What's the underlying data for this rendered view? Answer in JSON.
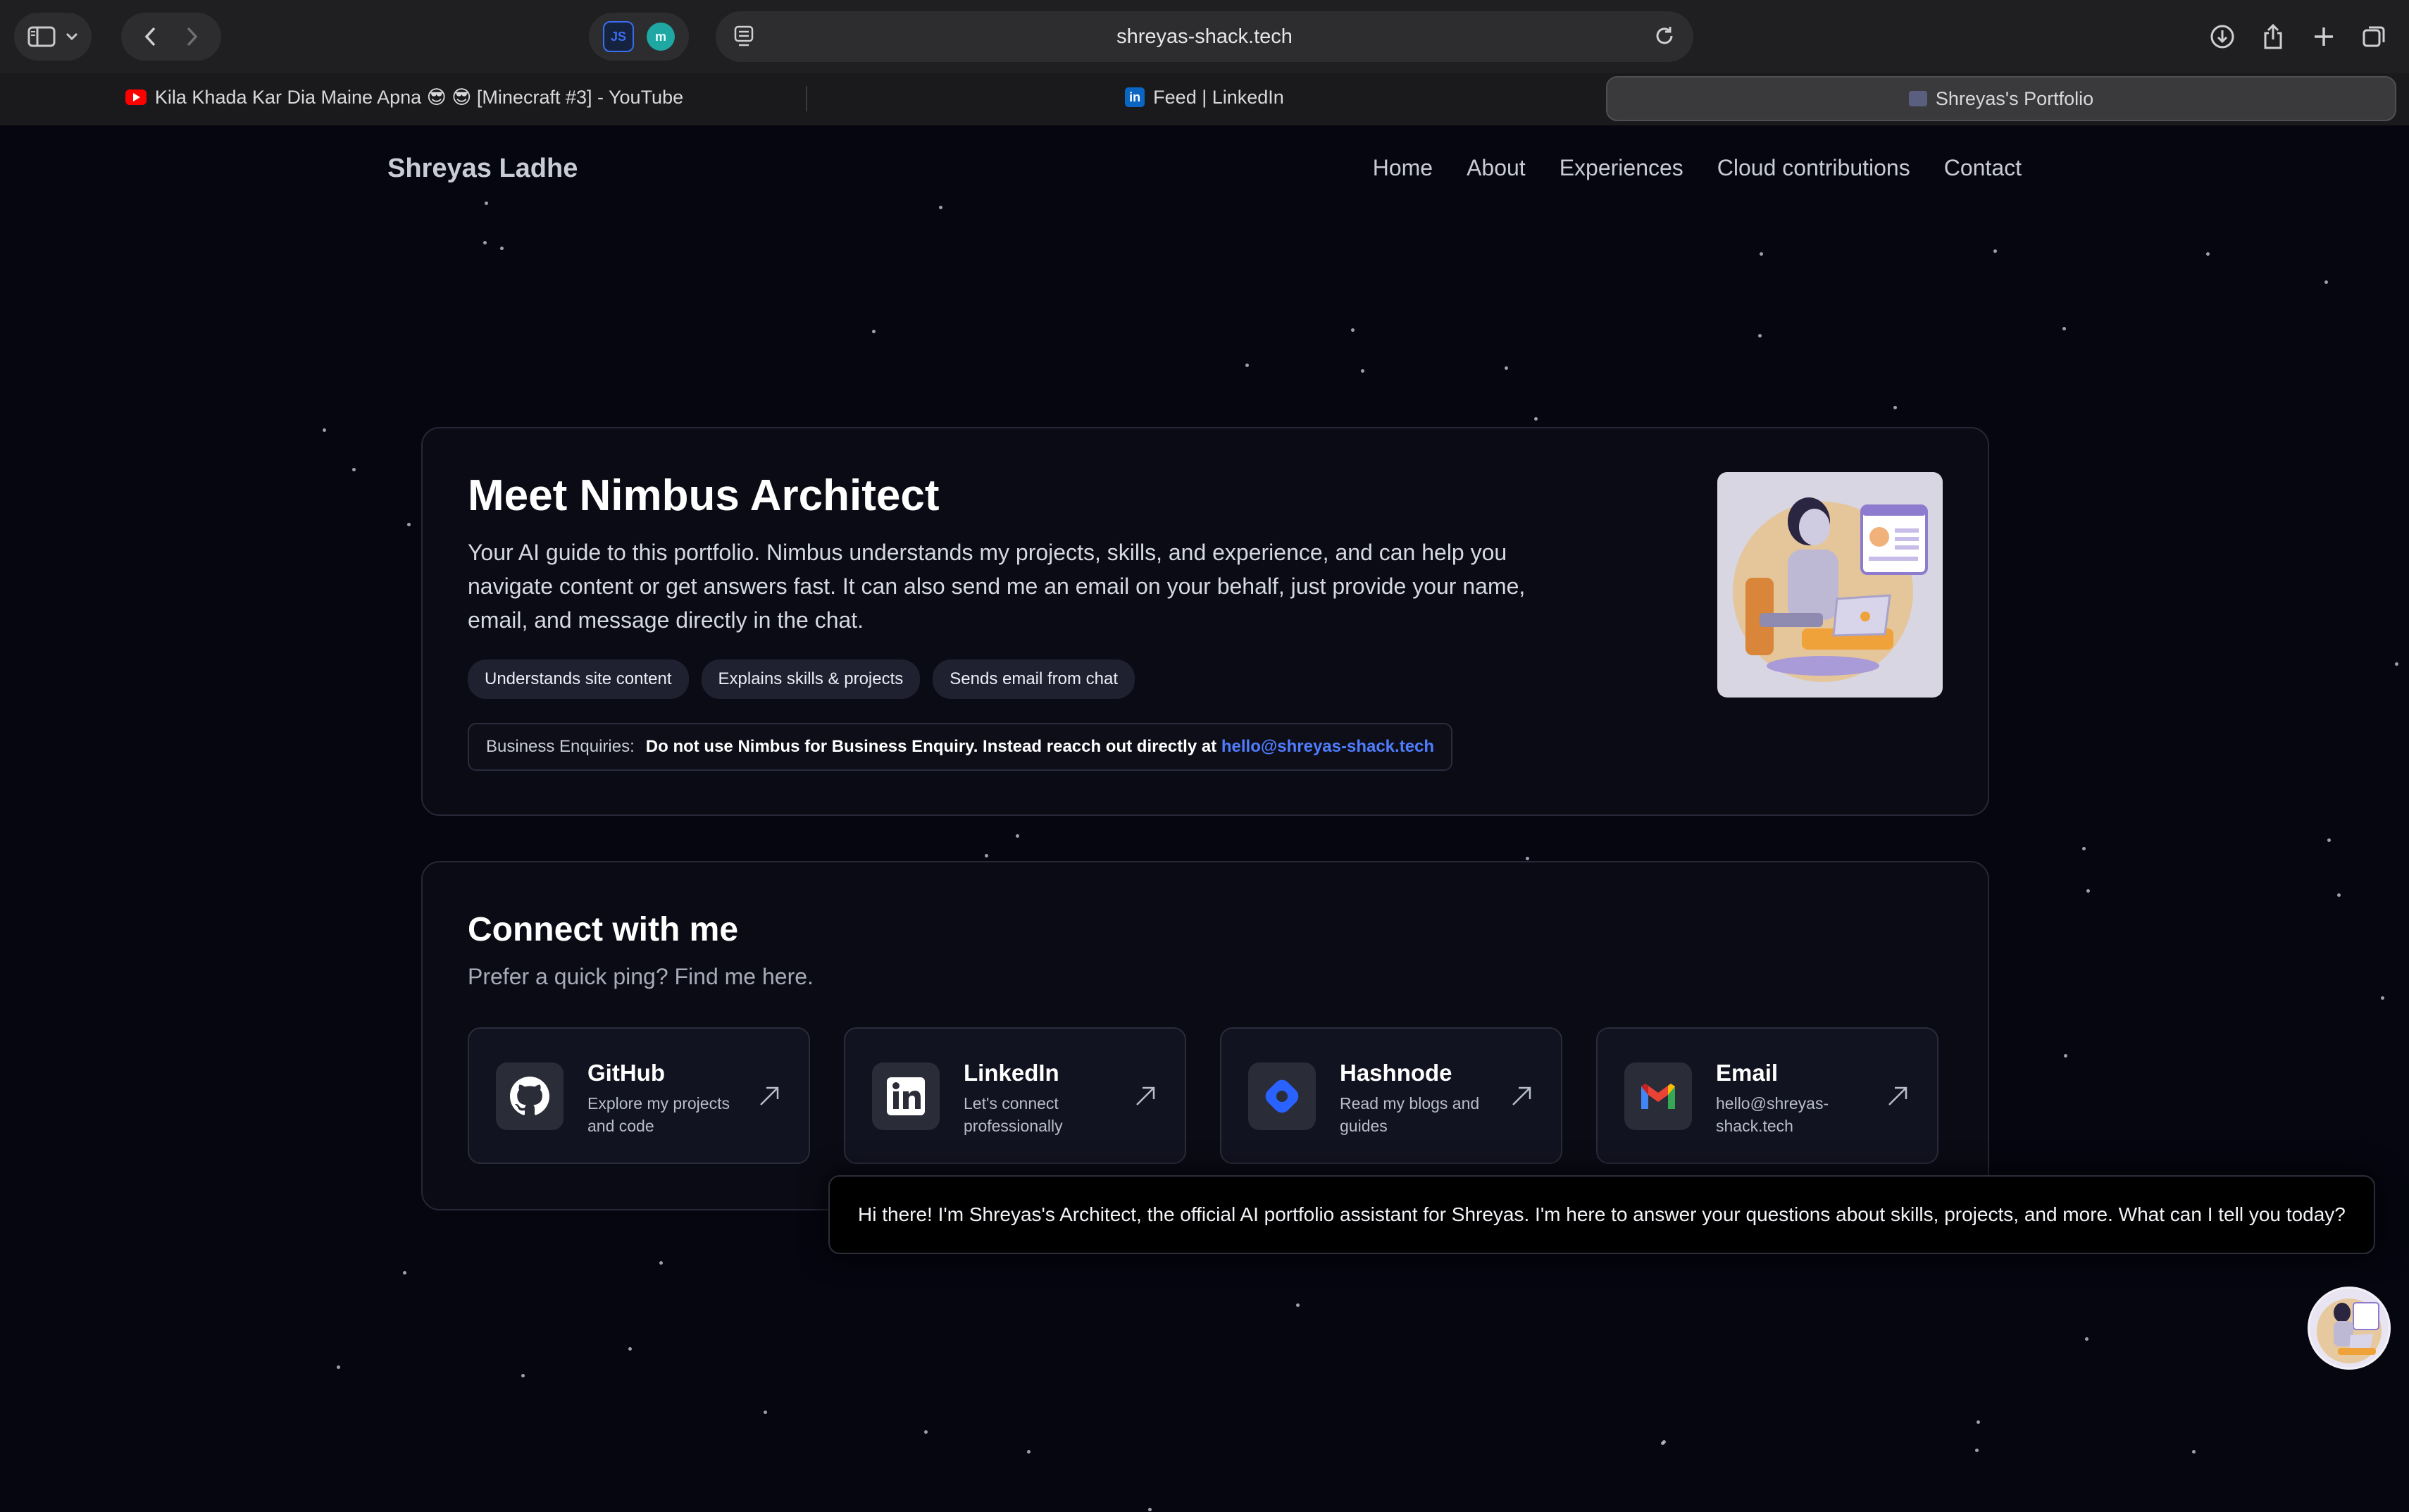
{
  "browser": {
    "url": "shreyas-shack.tech",
    "extensions": [
      {
        "name": "js-extension-icon",
        "label": "JS"
      },
      {
        "name": "m-extension-icon",
        "label": "m"
      }
    ],
    "tabs": [
      {
        "title": "Kila Khada Kar Dia Maine Apna 😎 😎 [Minecraft #3] - YouTube",
        "icon": "youtube-icon",
        "active": false
      },
      {
        "title": "Feed | LinkedIn",
        "icon": "linkedin-icon",
        "active": false
      },
      {
        "title": "Shreyas's Portfolio",
        "icon": "portfolio-icon",
        "active": true
      }
    ]
  },
  "site": {
    "brand": "Shreyas Ladhe",
    "nav": [
      "Home",
      "About",
      "Experiences",
      "Cloud contributions",
      "Contact"
    ]
  },
  "meet": {
    "title": "Meet Nimbus Architect",
    "description": "Your AI guide to this portfolio. Nimbus understands my projects, skills, and experience, and can help you navigate content or get answers fast. It can also send me an email on your behalf, just provide your name, email, and message directly in the chat.",
    "chips": [
      "Understands site content",
      "Explains skills & projects",
      "Sends email from chat"
    ],
    "enquiry_label": "Business Enquiries:",
    "enquiry_message": "Do not use Nimbus for Business Enquiry. Instead reacch out directly at",
    "enquiry_email": "hello@shreyas-shack.tech"
  },
  "connect": {
    "title": "Connect with me",
    "subtitle": "Prefer a quick ping? Find me here.",
    "links": [
      {
        "title": "GitHub",
        "desc": "Explore my projects and code",
        "icon": "github-icon"
      },
      {
        "title": "LinkedIn",
        "desc": "Let's connect professionally",
        "icon": "linkedin-icon"
      },
      {
        "title": "Hashnode",
        "desc": "Read my blogs and guides",
        "icon": "hashnode-icon"
      },
      {
        "title": "Email",
        "desc": "hello@shreyas-shack.tech",
        "icon": "gmail-icon"
      }
    ]
  },
  "chat": {
    "message": "Hi there! I'm Shreyas's Architect, the official AI portfolio assistant for Shreyas. I'm here to answer your questions about skills, projects, and more. What can I tell you today?"
  },
  "colors": {
    "background": "#05060f",
    "card": "#0a0b14",
    "accent_link": "#4f7dff"
  }
}
